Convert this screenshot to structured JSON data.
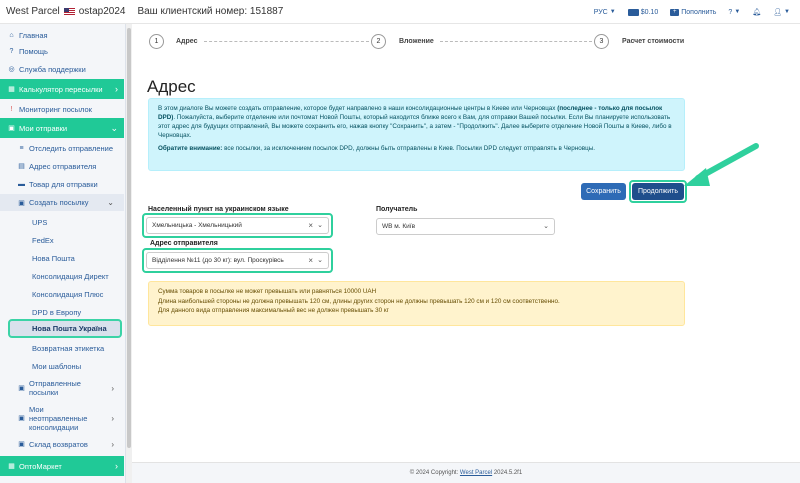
{
  "header": {
    "brand": "West Parcel",
    "username": "ostap2024",
    "client_number_label": "Ваш клиентский номер: 151887",
    "language": "РУС",
    "balance": "$0.10",
    "topup": "Пополнить"
  },
  "sidebar": {
    "home": "Главная",
    "help": "Помощь",
    "support": "Служба поддержки",
    "calculator": "Калькулятор пересылки",
    "monitoring": "Мониторинг посылок",
    "my_shipments": "Мои отправки",
    "track": "Отследить отправление",
    "sender_address": "Адрес отправителя",
    "goods": "Товар для отправки",
    "create_parcel": "Создать посылку",
    "carriers": [
      "UPS",
      "FedEx",
      "Нова Пошта",
      "Консолидация Директ",
      "Консолидация Плюс",
      "DPD в Европу"
    ],
    "active_item": "Нова Пошта Україна",
    "return_label": "Возвратная этикетка",
    "templates": "Мои шаблоны",
    "sent_parcels": "Отправленные посылки",
    "unsent_consolidations": "Мои неотправленные консолидации",
    "returns_warehouse": "Склад возвратов",
    "optomarket": "ОптоМаркет"
  },
  "steps": [
    {
      "num": "1",
      "label": "Адрес"
    },
    {
      "num": "2",
      "label": "Вложение"
    },
    {
      "num": "3",
      "label": "Расчет стоимости"
    }
  ],
  "main": {
    "title": "Адрес",
    "info_text_1": "В этом диалоге Вы можете создать отправление, которое будет направлено в наши консолидационные центры в Киеве или Черновцах ",
    "info_bold_1": "(последнее - только для посылок DPD)",
    "info_text_2": ". Пожалуйста, выберите отделение или почтомат Новой Пошты, который находится ближе всего к Вам, для отправки Вашей посылки. Если Вы планируете использовать этот адрес для будущих отправлений, Вы можете сохранить его, нажав кнопку \"Сохранить\", а затем - \"Продолжить\". Далее выберите отделение Новой Пошты в Киеве, либо в Черновцах.",
    "info_attention_bold": "Обратите внимание:",
    "info_attention_text": " все посылки, за исключением посылок DPD, должны быть отправлены в Киев. Посылки DPD следует отправлять в Черновцы.",
    "save_button": "Сохранить",
    "continue_button": "Продолжить",
    "city_label": "Населенный пункт на украинском языке",
    "city_value": "Хмельницька - Хмельницький",
    "recipient_label": "Получатель",
    "recipient_value": "WB м. Київ",
    "sender_label": "Адрес отправителя",
    "sender_value": "Відділення №11 (до 30 кг): вул. Проскурівсь",
    "warning_lines": [
      "Сумма товаров в посылке не может превышать или равняться 10000 UAH",
      "Длина наибольшей стороны не должна превышать 120 см, длины других сторон не должны превышать 120 см и 120 см соответственно.",
      "Для данного вида отправления максимальный вес не должен превышать 30 кг"
    ]
  },
  "footer": {
    "copyright": "© 2024 Copyright:",
    "link": "West Parcel",
    "version": "2024.5.2f1"
  }
}
